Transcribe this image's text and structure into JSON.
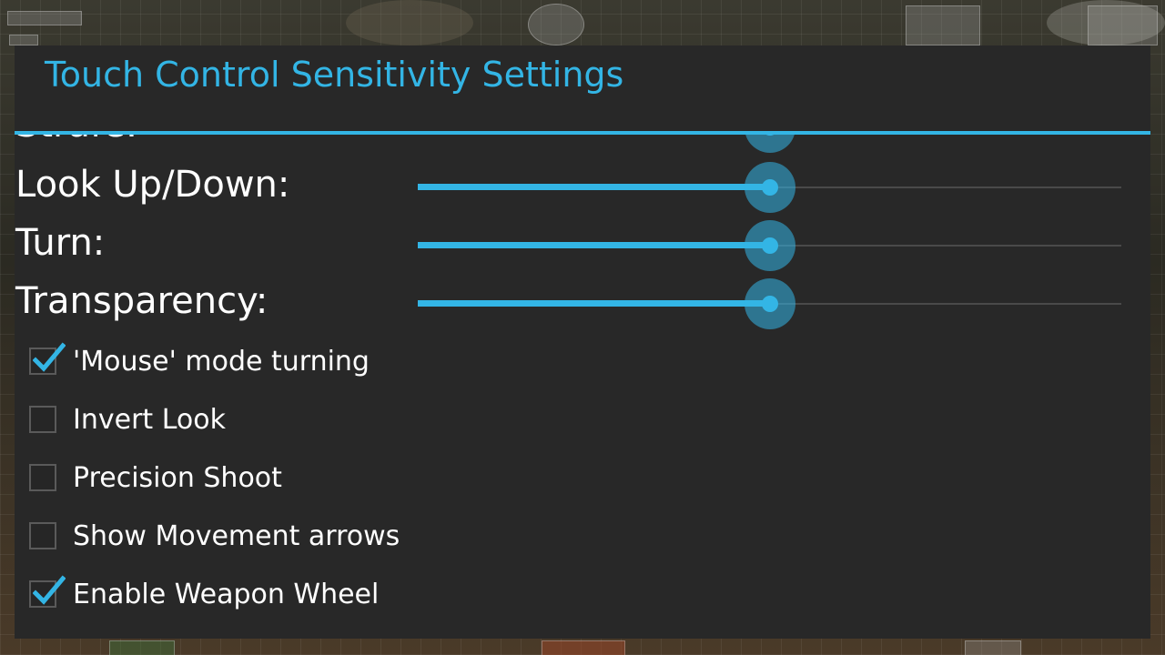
{
  "dialog": {
    "title": "Touch Control Sensitivity Settings"
  },
  "sliders": [
    {
      "label": "Strafe:",
      "value": 0.5
    },
    {
      "label": "Look Up/Down:",
      "value": 0.5
    },
    {
      "label": "Turn:",
      "value": 0.5
    },
    {
      "label": "Transparency:",
      "value": 0.5
    }
  ],
  "checkboxes": [
    {
      "label": "'Mouse' mode turning",
      "checked": true
    },
    {
      "label": "Invert Look",
      "checked": false
    },
    {
      "label": "Precision Shoot",
      "checked": false
    },
    {
      "label": "Show Movement arrows",
      "checked": false
    },
    {
      "label": "Enable Weapon Wheel",
      "checked": true
    }
  ],
  "colors": {
    "accent": "#33b5e5",
    "dialog_bg": "#282828",
    "text": "#ffffff"
  }
}
